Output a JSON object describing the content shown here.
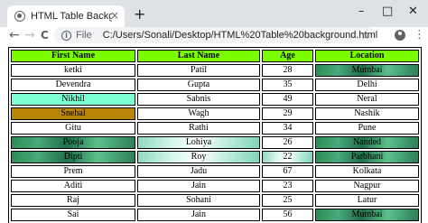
{
  "browser": {
    "tab_title": "HTML Table Background",
    "tab_close": "×",
    "new_tab": "+",
    "minimize": "–",
    "maximize": "□",
    "close": "✕",
    "back": "←",
    "forward": "→",
    "reload": "C",
    "info": "i",
    "file_label": "File",
    "url": "C:/Users/Sonali/Desktop/HTML%20Table%20background.html",
    "star": "☆",
    "menu": "⋮"
  },
  "table": {
    "headers": [
      "First Name",
      "Last Name",
      "Age",
      "Location"
    ],
    "rows": [
      {
        "first": "ketki",
        "last": "Patil",
        "age": "28",
        "location": "Mumbai"
      },
      {
        "first": "Devendra",
        "last": "Gupta",
        "age": "35",
        "location": "Delhi"
      },
      {
        "first": "Nikhil",
        "last": "Sabnis",
        "age": "49",
        "location": "Neral"
      },
      {
        "first": "Snehal",
        "last": "Wagh",
        "age": "29",
        "location": "Nashik"
      },
      {
        "first": "Gitu",
        "last": "Rathi",
        "age": "34",
        "location": "Pune"
      },
      {
        "first": "Pooja",
        "last": "Lohiya",
        "age": "26",
        "location": "Nanded"
      },
      {
        "first": "Dipti",
        "last": "Roy",
        "age": "22",
        "location": "Parbhani"
      },
      {
        "first": "Prem",
        "last": "Jadu",
        "age": "67",
        "location": "Kolkata"
      },
      {
        "first": "Aditi",
        "last": "Jain",
        "age": "23",
        "location": "Nagpur"
      },
      {
        "first": "Raj",
        "last": "Sohani",
        "age": "25",
        "location": "Latur"
      },
      {
        "first": "Sai",
        "last": "Jain",
        "age": "56",
        "location": "Mumbai"
      }
    ]
  },
  "colors": {
    "header_bg": "#7cfc00",
    "aqua": "#7fffd4",
    "gold": "#b8860b"
  }
}
